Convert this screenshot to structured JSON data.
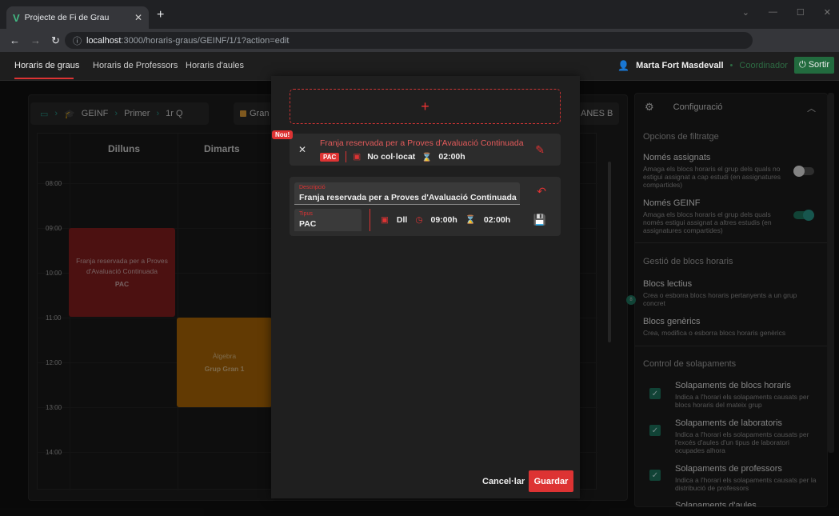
{
  "browser": {
    "tab_title": "Projecte de Fi de Grau",
    "url_host": "localhost",
    "url_path": ":3000/horaris-graus/GEINF/1/1?action=edit"
  },
  "appnav": {
    "tabs": [
      "Horaris de graus",
      "Horaris de Professors",
      "Horaris d'aules"
    ],
    "user_name": "Marta Fort Masdevall",
    "role": "Coordinador",
    "logout_label": "Sortir"
  },
  "breadcrumb": {
    "grau": "GEINF",
    "curs": "Primer",
    "quad": "1r Q"
  },
  "grup_label": "Gran",
  "aules_label": "ANES B",
  "calendar": {
    "days": [
      "Dilluns",
      "Dimarts"
    ],
    "hours": [
      "08:00",
      "09:00",
      "10:00",
      "11:00",
      "12:00",
      "13:00",
      "14:00"
    ],
    "events": [
      {
        "title": "Franja reservada per a Proves d'Avaluació Continuada",
        "sub": "PAC"
      },
      {
        "title": "Àlgebra",
        "sub": "Grup Gran 1"
      }
    ]
  },
  "config": {
    "title": "Configuració",
    "filter_header": "Opcions de filtratge",
    "options": [
      {
        "title": "Només assignats",
        "desc": "Amaga els blocs horaris el grup dels quals no estigui assignat a cap estudi (en assignatures compartides)",
        "on": false
      },
      {
        "title": "Només GEINF",
        "desc": "Amaga els blocs horaris el grup dels quals només estigui assignat a altres estudis (en assignatures compartides)",
        "on": true
      }
    ],
    "blocks_header": "Gestió de blocs horaris",
    "blocks": [
      {
        "title": "Blocs lectius",
        "desc": "Crea o esborra blocs horaris pertanyents a un grup concret"
      },
      {
        "title": "Blocs genèrics",
        "desc": "Crea, modifica o esborra blocs horaris genèrics"
      }
    ],
    "overlap_header": "Control de solapaments",
    "overlaps": [
      {
        "title": "Solapaments de blocs horaris",
        "desc": "Indica a l'horari els solapaments causats per blocs horaris del mateix grup"
      },
      {
        "title": "Solapaments de laboratoris",
        "desc": "Indica a l'horari els solapaments causats per l'excés d'aules d'un tipus de laboratori ocupades alhora"
      },
      {
        "title": "Solapaments de professors",
        "desc": "Indica a l'horari els solapaments causats per la distribució de professors"
      },
      {
        "title": "Solapaments d'aules",
        "desc": ""
      }
    ],
    "dot_label": "8"
  },
  "modal": {
    "add_symbol": "+",
    "block": {
      "title": "Franja reservada per a Proves d'Avaluació Continuada",
      "tag": "PAC",
      "placement": "No col·locat",
      "duration": "02:00h",
      "badge": "Nou!"
    },
    "edit": {
      "desc_label": "Descripció",
      "desc_value": "Franja reservada per a Proves d'Avaluació Continuada",
      "tipus_label": "Tipus",
      "tipus_value": "PAC",
      "day": "Dll",
      "start": "09:00h",
      "duration": "02:00h"
    },
    "cancel_label": "Cancel·lar",
    "save_label": "Guardar"
  },
  "colors": {
    "accent": "#dd3333",
    "teal": "#1f7a63",
    "event_red": "#8b2020",
    "event_orange": "#b36b07"
  }
}
